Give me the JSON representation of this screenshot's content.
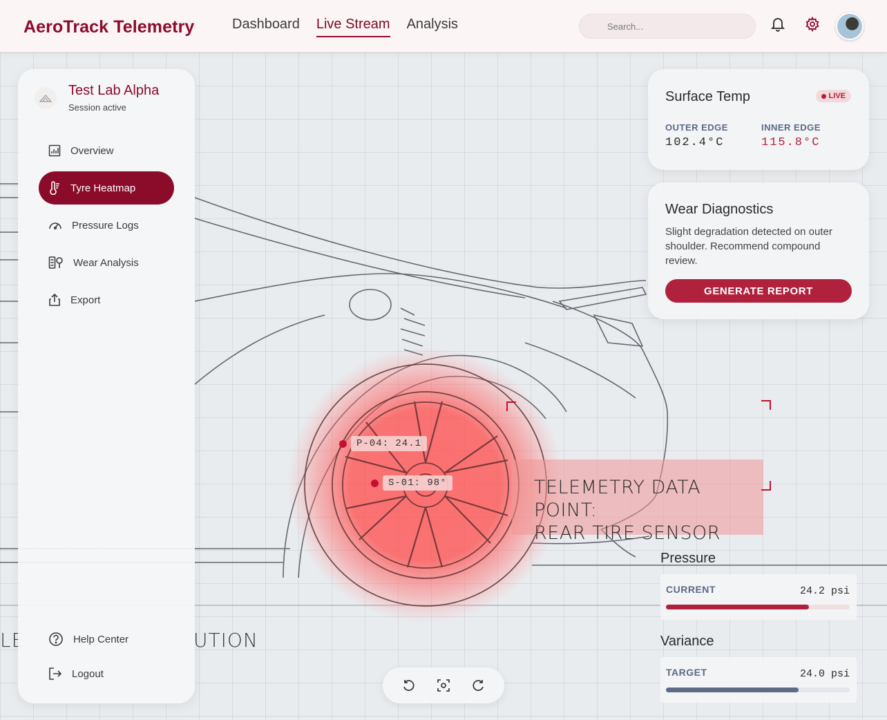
{
  "app": {
    "brand": "AeroTrack Telemetry"
  },
  "nav": [
    {
      "label": "Dashboard",
      "active": false
    },
    {
      "label": "Live Stream",
      "active": true
    },
    {
      "label": "Analysis",
      "active": false
    }
  ],
  "search": {
    "placeholder": "Search..."
  },
  "header_icons": [
    "bell-icon",
    "gear-icon"
  ],
  "sidebar": {
    "title": "Test Lab Alpha",
    "subtitle": "Session active",
    "items": [
      {
        "label": "Overview",
        "icon": "chart-icon",
        "active": false
      },
      {
        "label": "Tyre Heatmap",
        "icon": "thermometer-icon",
        "active": true
      },
      {
        "label": "Pressure Logs",
        "icon": "gauge-icon",
        "active": false
      },
      {
        "label": "Wear Analysis",
        "icon": "wear-analysis-icon",
        "active": false
      },
      {
        "label": "Export",
        "icon": "export-icon",
        "active": false
      }
    ],
    "footer": [
      {
        "label": "Help Center",
        "icon": "help-icon"
      },
      {
        "label": "Logout",
        "icon": "logout-icon"
      }
    ]
  },
  "surface_temp": {
    "title": "Surface Temp",
    "badge": "LIVE",
    "outer": {
      "label": "OUTER EDGE",
      "value": "102.4°C"
    },
    "inner": {
      "label": "INNER EDGE",
      "value": "115.8°C"
    },
    "colors": {
      "outer": "#2a2a2a",
      "inner": "#b0213d"
    }
  },
  "wear": {
    "title": "Wear Diagnostics",
    "text": "Slight degradation detected on outer shoulder. Recommend compound review.",
    "button": "GENERATE REPORT"
  },
  "pressure": {
    "title": "Pressure",
    "label": "CURRENT",
    "value": "24.2 psi",
    "fill": 0.78,
    "color": "#b0213d"
  },
  "variance": {
    "title": "Variance",
    "label": "TARGET",
    "value": "24.0 psi",
    "fill": 0.72,
    "color": "#5e6b85"
  },
  "overlay": {
    "tag1": "P-04: 24.1",
    "tag2": "S-01: 98°",
    "telemetry_line1": "TELEMETRY DATA POINT:",
    "telemetry_line2": "REAR TIRE SENSOR",
    "bg_caption_left": "LE",
    "bg_caption_right": "UTION"
  },
  "controls": [
    "rotate-left-icon",
    "focus-icon",
    "rotate-right-icon"
  ],
  "accent": "#8c0b2a"
}
